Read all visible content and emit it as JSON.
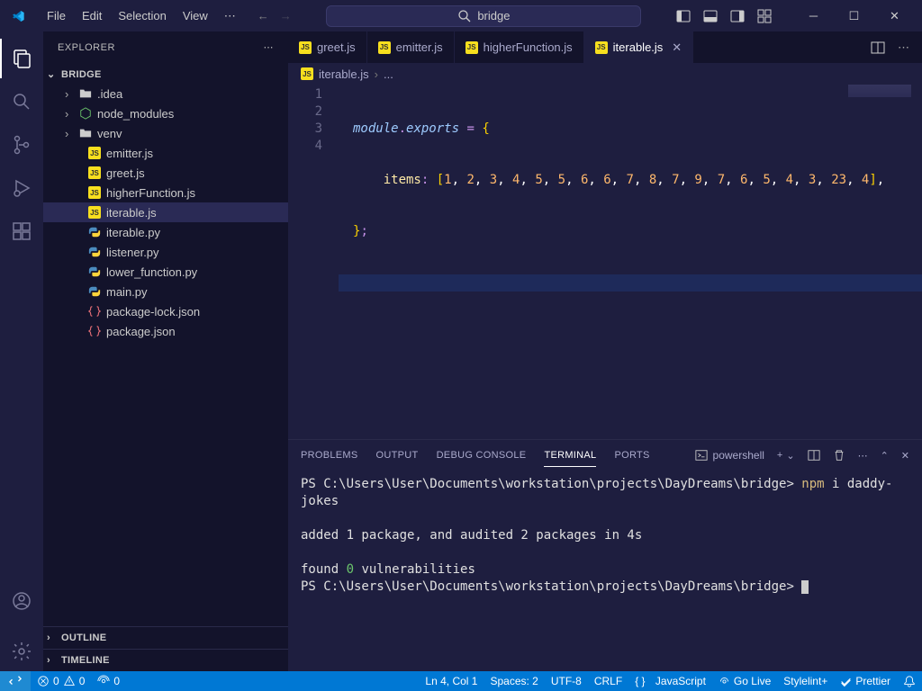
{
  "menu": {
    "file": "File",
    "edit": "Edit",
    "selection": "Selection",
    "view": "View"
  },
  "search": {
    "text": "bridge"
  },
  "explorer": {
    "title": "EXPLORER",
    "project": "BRIDGE",
    "tree": [
      {
        "label": ".idea",
        "type": "folder",
        "icon": "folder"
      },
      {
        "label": "node_modules",
        "type": "folder",
        "icon": "node"
      },
      {
        "label": "venv",
        "type": "folder",
        "icon": "folder"
      },
      {
        "label": "emitter.js",
        "type": "file",
        "icon": "js"
      },
      {
        "label": "greet.js",
        "type": "file",
        "icon": "js"
      },
      {
        "label": "higherFunction.js",
        "type": "file",
        "icon": "js"
      },
      {
        "label": "iterable.js",
        "type": "file",
        "icon": "js",
        "selected": true
      },
      {
        "label": "iterable.py",
        "type": "file",
        "icon": "py"
      },
      {
        "label": "listener.py",
        "type": "file",
        "icon": "py"
      },
      {
        "label": "lower_function.py",
        "type": "file",
        "icon": "py"
      },
      {
        "label": "main.py",
        "type": "file",
        "icon": "py"
      },
      {
        "label": "package-lock.json",
        "type": "file",
        "icon": "json"
      },
      {
        "label": "package.json",
        "type": "file",
        "icon": "json"
      }
    ],
    "outline": "OUTLINE",
    "timeline": "TIMELINE"
  },
  "tabs": [
    {
      "label": "greet.js"
    },
    {
      "label": "emitter.js"
    },
    {
      "label": "higherFunction.js"
    },
    {
      "label": "iterable.js",
      "active": true
    }
  ],
  "breadcrumb": {
    "file": "iterable.js",
    "rest": "..."
  },
  "code": {
    "line1_a": "module",
    "line1_b": ".",
    "line1_c": "exports",
    "line1_d": " = ",
    "line1_e": "{",
    "line2_a": "    items",
    "line2_b": ": ",
    "line2_c": "[",
    "line2_nums": "1, 2, 3, 4, 5, 5, 6, 6, 7, 8, 7, 9, 7, 6, 5, 4, 3, 23, 4",
    "line2_d": "]",
    "line2_e": ",",
    "line3_a": "}",
    "line3_b": ";",
    "ln1": "1",
    "ln2": "2",
    "ln3": "3",
    "ln4": "4"
  },
  "panel": {
    "problems": "PROBLEMS",
    "output": "OUTPUT",
    "debug": "DEBUG CONSOLE",
    "terminal": "TERMINAL",
    "ports": "PORTS",
    "shell": "powershell"
  },
  "terminal": {
    "l1_a": "PS C:\\Users\\User\\Documents\\workstation\\projects\\DayDreams\\bridge> ",
    "l1_b": "npm ",
    "l1_c": "i daddy-jokes",
    "l2": "added 1 package, and audited 2 packages in 4s",
    "l3_a": "found ",
    "l3_b": "0",
    "l3_c": " vulnerabilities",
    "l4": "PS C:\\Users\\User\\Documents\\workstation\\projects\\DayDreams\\bridge> "
  },
  "status": {
    "err": "0",
    "warn": "0",
    "ports": "0",
    "ln": "Ln 4, Col 1",
    "spaces": "Spaces: 2",
    "enc": "UTF-8",
    "eol": "CRLF",
    "lang": "JavaScript",
    "golive": "Go Live",
    "stylelint": "Stylelint+",
    "prettier": "Prettier"
  }
}
